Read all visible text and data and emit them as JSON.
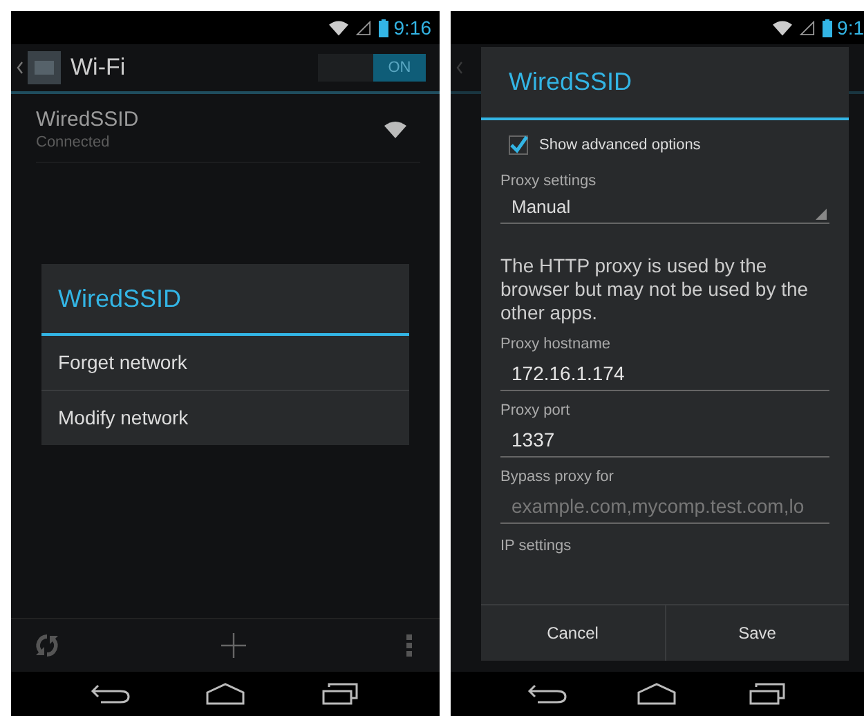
{
  "left_screen": {
    "status_bar": {
      "time": "9:16"
    },
    "action_bar": {
      "title": "Wi-Fi",
      "toggle": {
        "label": "ON",
        "on": true
      }
    },
    "networks": [
      {
        "name": "WiredSSID",
        "status": "Connected"
      }
    ],
    "dialog": {
      "title": "WiredSSID",
      "items": [
        "Forget network",
        "Modify network"
      ]
    }
  },
  "right_screen": {
    "status_bar": {
      "time": "9:1"
    },
    "dialog": {
      "title": "WiredSSID",
      "checkbox": {
        "label": "Show advanced options",
        "checked": true
      },
      "fields": [
        {
          "kind": "spinner",
          "label": "Proxy settings",
          "value": "Manual"
        },
        {
          "kind": "note",
          "text": "The HTTP proxy is used by the browser but may not be used by the other apps."
        },
        {
          "kind": "input",
          "label": "Proxy hostname",
          "value": "172.16.1.174"
        },
        {
          "kind": "input",
          "label": "Proxy port",
          "value": "1337"
        },
        {
          "kind": "input",
          "label": "Bypass proxy for",
          "placeholder": "example.com,mycomp.test.com,lo"
        },
        {
          "kind": "section",
          "label": "IP settings"
        }
      ],
      "buttons": [
        "Cancel",
        "Save"
      ]
    }
  }
}
